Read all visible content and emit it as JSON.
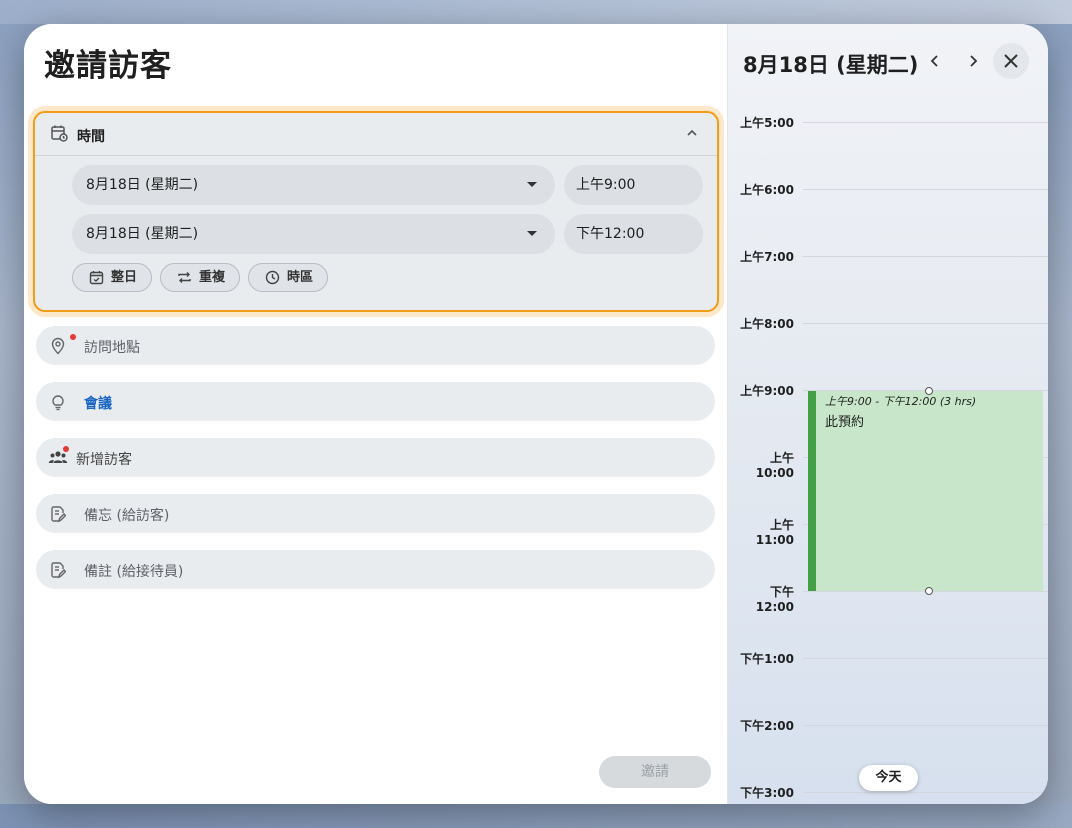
{
  "dialog": {
    "title": "邀請訪客",
    "time_section": {
      "label": "時間",
      "start_date": "8月18日 (星期二)",
      "start_time": "上午9:00",
      "end_date": "8月18日 (星期二)",
      "end_time": "下午12:00",
      "chips": [
        "整日",
        "重複",
        "時區"
      ]
    },
    "fields": {
      "location_placeholder": "訪問地點",
      "meeting_label": "會議",
      "add_visitor_label": "新增訪客",
      "memo_visitor_placeholder": "備忘 (給訪客)",
      "memo_receptionist_placeholder": "備註 (給接待員)"
    },
    "invite_label": "邀請"
  },
  "calendar": {
    "date_title": "8月18日 (星期二)",
    "hours": [
      "上午5:00",
      "上午6:00",
      "上午7:00",
      "上午8:00",
      "上午9:00",
      "上午10:00",
      "上午11:00",
      "下午12:00",
      "下午1:00",
      "下午2:00",
      "下午3:00"
    ],
    "event": {
      "time_range": "上午9:00 - 下午12:00 (3 hrs)",
      "name": "此預約",
      "color": "#c8e6c9",
      "accent": "#43a047"
    },
    "today_label": "今天"
  },
  "colors": {
    "focus_border": "#f29c1a",
    "meeting_text": "#1a66c2",
    "required_dot": "#e53935"
  },
  "icons": [
    "calendar-clock-icon",
    "chevron-up-icon",
    "dropdown-arrow-icon",
    "calendar-check-icon",
    "repeat-icon",
    "clock-icon",
    "location-pin-icon",
    "lightbulb-icon",
    "people-icon",
    "edit-note-icon",
    "chevron-left-icon",
    "chevron-right-icon",
    "close-icon"
  ]
}
